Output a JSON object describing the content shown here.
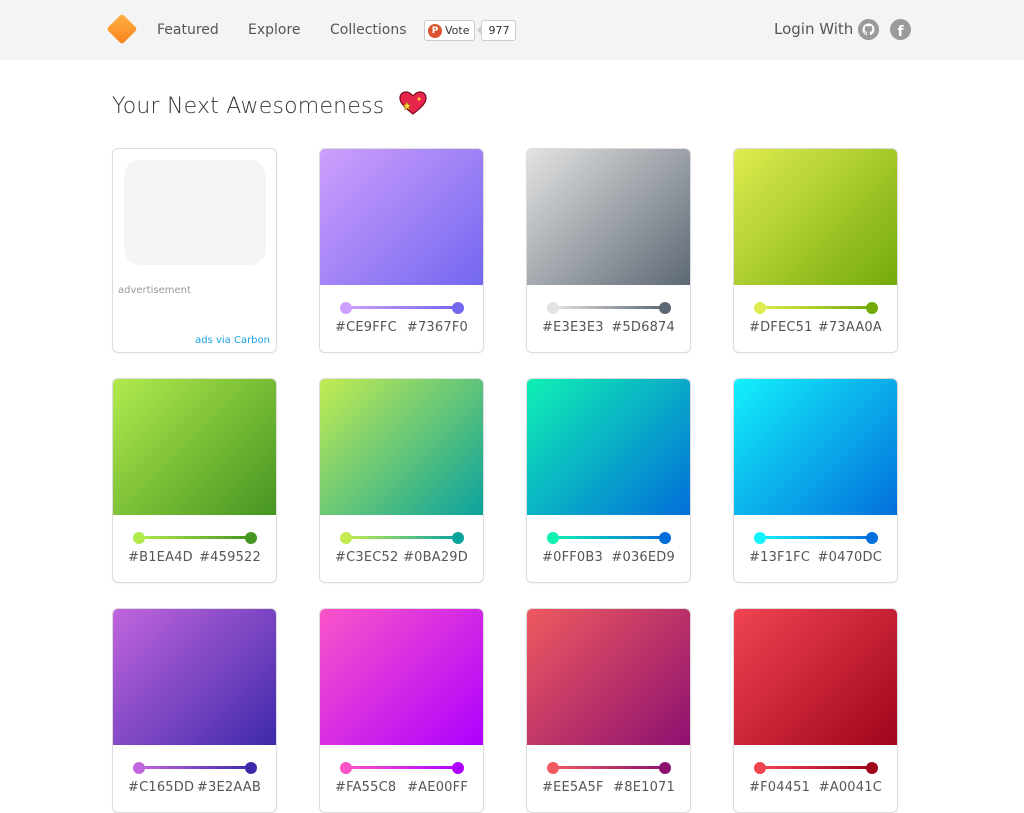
{
  "header": {
    "nav": [
      "Featured",
      "Explore",
      "Collections"
    ],
    "producthunt": {
      "logo_letter": "P",
      "vote_label": "Vote",
      "count": "977"
    },
    "login_label": "Login With",
    "facebook_glyph": "f",
    "colors": {
      "logo_start": "#FFB347",
      "logo_end": "#F7811B",
      "icons": "#9a9a9a"
    }
  },
  "page": {
    "title": "Your Next Awesomeness"
  },
  "ad": {
    "label": "advertisement",
    "link": "ads via Carbon"
  },
  "gradients": [
    {
      "start": "#CE9FFC",
      "end": "#7367F0"
    },
    {
      "start": "#E3E3E3",
      "end": "#5D6874"
    },
    {
      "start": "#DFEC51",
      "end": "#73AA0A"
    },
    {
      "start": "#B1EA4D",
      "end": "#459522"
    },
    {
      "start": "#C3EC52",
      "end": "#0BA29D"
    },
    {
      "start": "#0FF0B3",
      "end": "#036ED9"
    },
    {
      "start": "#13F1FC",
      "end": "#0470DC"
    },
    {
      "start": "#C165DD",
      "end": "#3E2AAB"
    },
    {
      "start": "#FA55C8",
      "end": "#AE00FF"
    },
    {
      "start": "#EE5A5F",
      "end": "#8E1071"
    },
    {
      "start": "#F04451",
      "end": "#A0041C"
    }
  ]
}
